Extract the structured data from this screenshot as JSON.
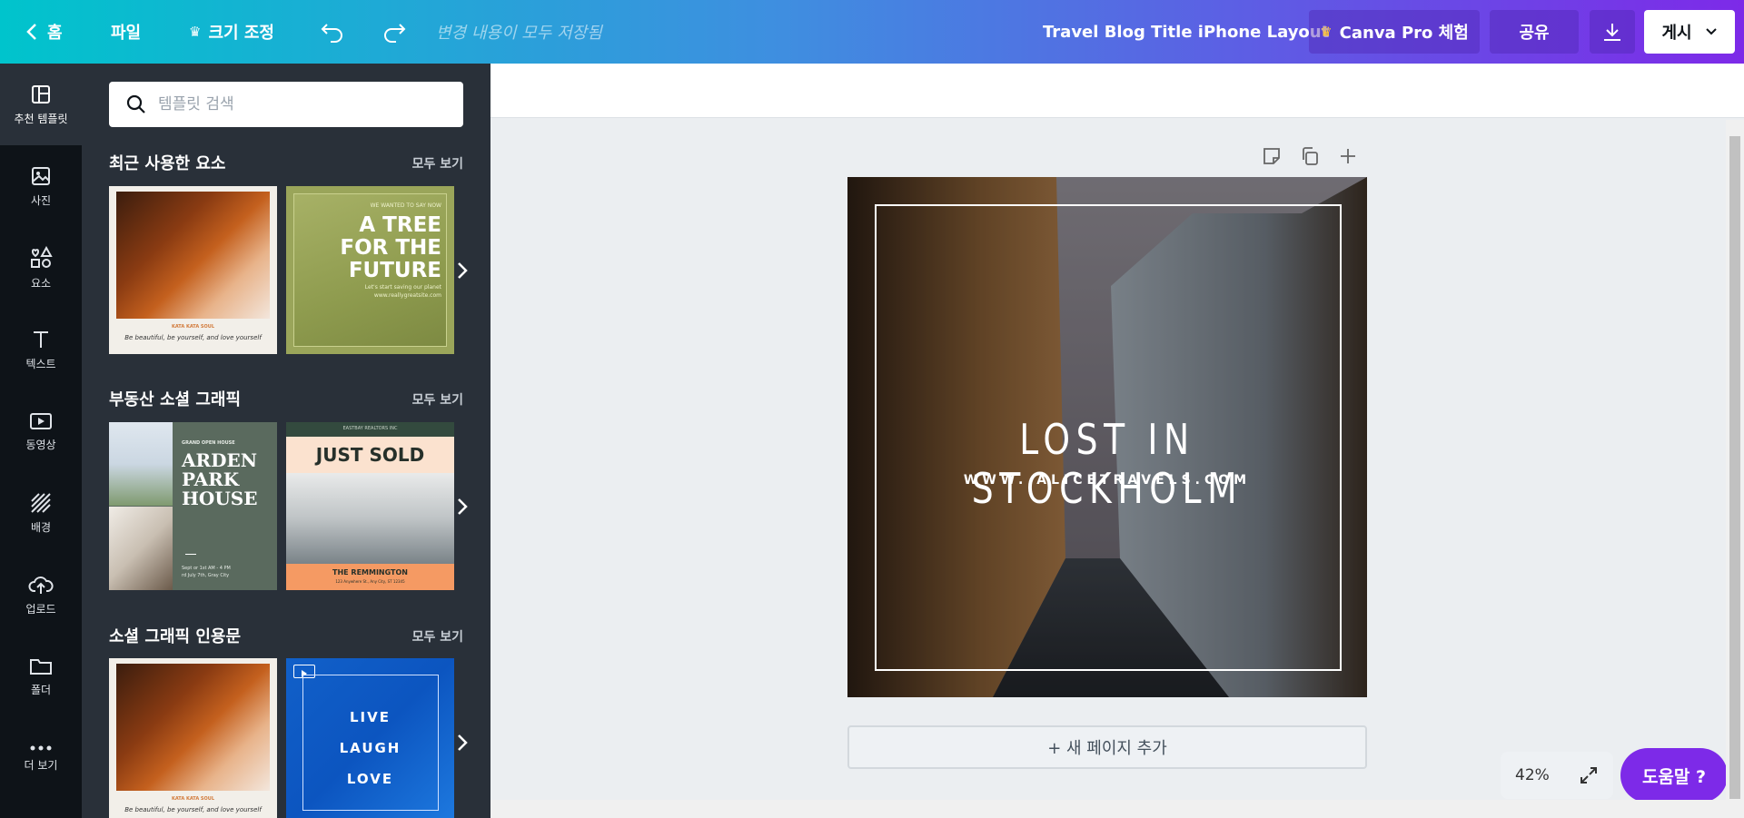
{
  "topbar": {
    "home_label": "홈",
    "file_label": "파일",
    "resize_label": "크기 조정",
    "saved_status": "변경 내용이 모두 저장됨",
    "doc_title": "Travel Blog Title iPhone Layout",
    "pro_label": "Canva Pro 체험",
    "share_label": "공유",
    "publish_label": "게시",
    "crown_color": "#ffc633"
  },
  "rail": {
    "items": [
      {
        "label": "추천 템플릿",
        "icon": "template-icon"
      },
      {
        "label": "사진",
        "icon": "photo-icon"
      },
      {
        "label": "요소",
        "icon": "elements-icon"
      },
      {
        "label": "텍스트",
        "icon": "text-icon"
      },
      {
        "label": "동영상",
        "icon": "video-icon"
      },
      {
        "label": "배경",
        "icon": "background-icon"
      },
      {
        "label": "업로드",
        "icon": "upload-icon"
      },
      {
        "label": "폴더",
        "icon": "folder-icon"
      },
      {
        "label": "더 보기",
        "icon": "more-icon"
      }
    ]
  },
  "panel": {
    "search_placeholder": "템플릿 검색",
    "see_all": "모두 보기",
    "sections": [
      {
        "title": "최근 사용한 요소"
      },
      {
        "title": "부동산 소셜 그래픽"
      },
      {
        "title": "소셜 그래픽 인용문"
      }
    ],
    "thumbs": {
      "t2_small": "WE WANTED TO SAY NOW",
      "t2_big1": "A TREE",
      "t2_big2": "FOR THE",
      "t2_big3": "FUTURE",
      "t2_line1": "Let's start saving our planet",
      "t2_line2": "www.reallygreatsite.com",
      "t1_tag": "KATA KATA SOUL",
      "t1_quote": "Be beautiful, be yourself, and love yourself",
      "t3_small": "GRAND OPEN HOUSE",
      "t3_big1": "ARDEN",
      "t3_big2": "PARK",
      "t3_big3": "HOUSE",
      "t3_info1": "Sept or 1st AM - 4 PM",
      "t3_info2": "rd July 7th, Gray City",
      "t4_small": "EASTBAY REALTORS INC",
      "t4_big": "JUST SOLD",
      "t4_name": "THE REMMINGTON",
      "t4_addr": "123 Anywhere St., Any City, ST 12345",
      "t6_l1": "LIVE",
      "t6_l2": "LAUGH",
      "t6_l3": "LOVE"
    }
  },
  "canvas": {
    "title": "LOST IN STOCKHOLM",
    "subtitle": "WWW. ALICETRAVELS.COM",
    "add_page": "+ 새 페이지 추가"
  },
  "zoom": {
    "level": "42%"
  },
  "help": {
    "label": "도움말 ?"
  }
}
